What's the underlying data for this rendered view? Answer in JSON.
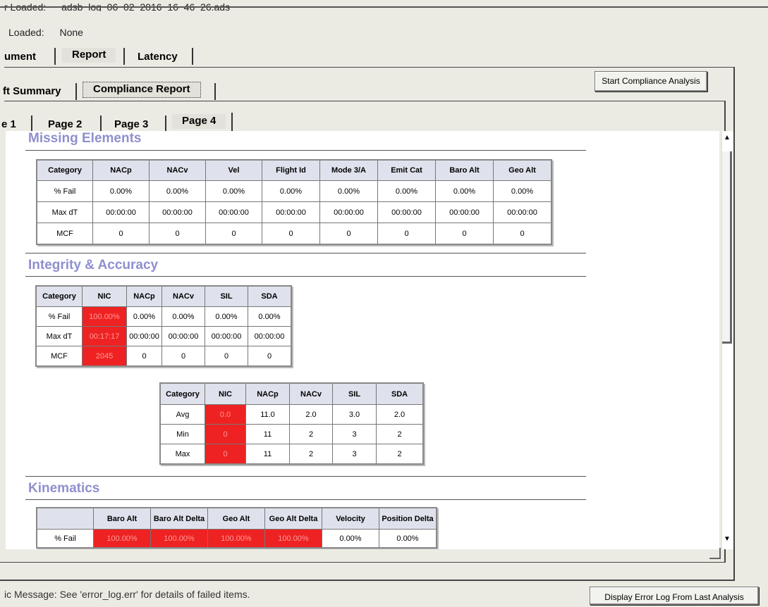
{
  "header": {
    "file_label": "r Loaded:",
    "file_value": "adsb_log_06_02_2016_16_46_26.ads",
    "second_label": "Loaded:",
    "second_value": "None"
  },
  "tabs_main": [
    "ument",
    "Report",
    "Latency"
  ],
  "tabs_report": [
    "ft Summary",
    "Compliance Report"
  ],
  "tabs_pages": [
    "e 1",
    "Page 2",
    "Page 3",
    "Page 4"
  ],
  "buttons": {
    "start_analysis": "Start Compliance Analysis",
    "display_error_log": "Display Error Log From Last Analysis"
  },
  "status": {
    "message": "ic Message:  See 'error_log.err' for details of failed items."
  },
  "sections": {
    "missing": "Missing Elements",
    "integrity": "Integrity & Accuracy",
    "kinematics": "Kinematics"
  },
  "missing_table": {
    "headers": [
      "Category",
      "NACp",
      "NACv",
      "Vel",
      "Flight Id",
      "Mode 3/A",
      "Emit Cat",
      "Baro Alt",
      "Geo Alt"
    ],
    "rows": [
      [
        "% Fail",
        "0.00%",
        "0.00%",
        "0.00%",
        "0.00%",
        "0.00%",
        "0.00%",
        "0.00%",
        "0.00%"
      ],
      [
        "Max dT",
        "00:00:00",
        "00:00:00",
        "00:00:00",
        "00:00:00",
        "00:00:00",
        "00:00:00",
        "00:00:00",
        "00:00:00"
      ],
      [
        "MCF",
        "0",
        "0",
        "0",
        "0",
        "0",
        "0",
        "0",
        "0"
      ]
    ]
  },
  "integrity_table1": {
    "headers": [
      "Category",
      "NIC",
      "NACp",
      "NACv",
      "SIL",
      "SDA"
    ],
    "rows": [
      [
        "% Fail",
        "100.00%",
        "0.00%",
        "0.00%",
        "0.00%",
        "0.00%"
      ],
      [
        "Max dT",
        "00:17:17",
        "00:00:00",
        "00:00:00",
        "00:00:00",
        "00:00:00"
      ],
      [
        "MCF",
        "2045",
        "0",
        "0",
        "0",
        "0"
      ]
    ],
    "failed_column": 1
  },
  "integrity_table2": {
    "headers": [
      "Category",
      "NIC",
      "NACp",
      "NACv",
      "SIL",
      "SDA"
    ],
    "rows": [
      [
        "Avg",
        "0.0",
        "11.0",
        "2.0",
        "3.0",
        "2.0"
      ],
      [
        "Min",
        "0",
        "11",
        "2",
        "3",
        "2"
      ],
      [
        "Max",
        "0",
        "11",
        "2",
        "3",
        "2"
      ]
    ],
    "failed_column": 1
  },
  "kinematics_table": {
    "headers": [
      "",
      "Baro Alt",
      "Baro Alt Delta",
      "Geo Alt",
      "Geo Alt Delta",
      "Velocity",
      "Position Delta"
    ],
    "rows": [
      [
        "% Fail",
        "100.00%",
        "100.00%",
        "100.00%",
        "100.00%",
        "0.00%",
        "0.00%"
      ]
    ],
    "failed_columns": [
      1,
      2,
      3,
      4
    ]
  },
  "colors": {
    "fail": "#ee2222",
    "section_title": "#8f8fcf",
    "header_bg": "#dfe2ec"
  }
}
